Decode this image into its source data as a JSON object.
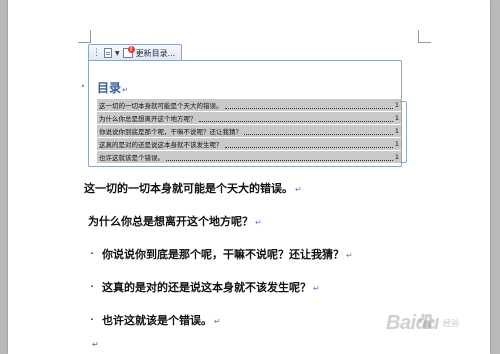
{
  "toolbar": {
    "update_label": "更新目录..."
  },
  "toc": {
    "title": "目录",
    "entries": [
      {
        "text": "这一切的一切本身就可能是个天大的错误。",
        "page": "1"
      },
      {
        "text": "为什么你总是想离开这个地方呢？",
        "page": "1"
      },
      {
        "text": "你说说你到底是那个呢，干嘛不说呢？还让我猜？",
        "page": "1"
      },
      {
        "text": "这真的是对的还是说这本身就不该发生呢？",
        "page": "1"
      },
      {
        "text": "也许这就该是个错误。",
        "page": "1"
      }
    ]
  },
  "body": {
    "headings": [
      "这一切的一切本身就可能是个天大的错误。",
      "为什么你总是想离开这个地方呢？",
      "你说说你到底是那个呢，干嘛不说呢？还让我猜？",
      "这真的是对的还是说这本身就不该发生呢？",
      "也许这就该是个错误。"
    ]
  },
  "watermark": {
    "brand": "Baidu",
    "sub": "经验"
  },
  "icons": {
    "update": "update-toc-icon",
    "doc": "toc-menu-icon"
  }
}
